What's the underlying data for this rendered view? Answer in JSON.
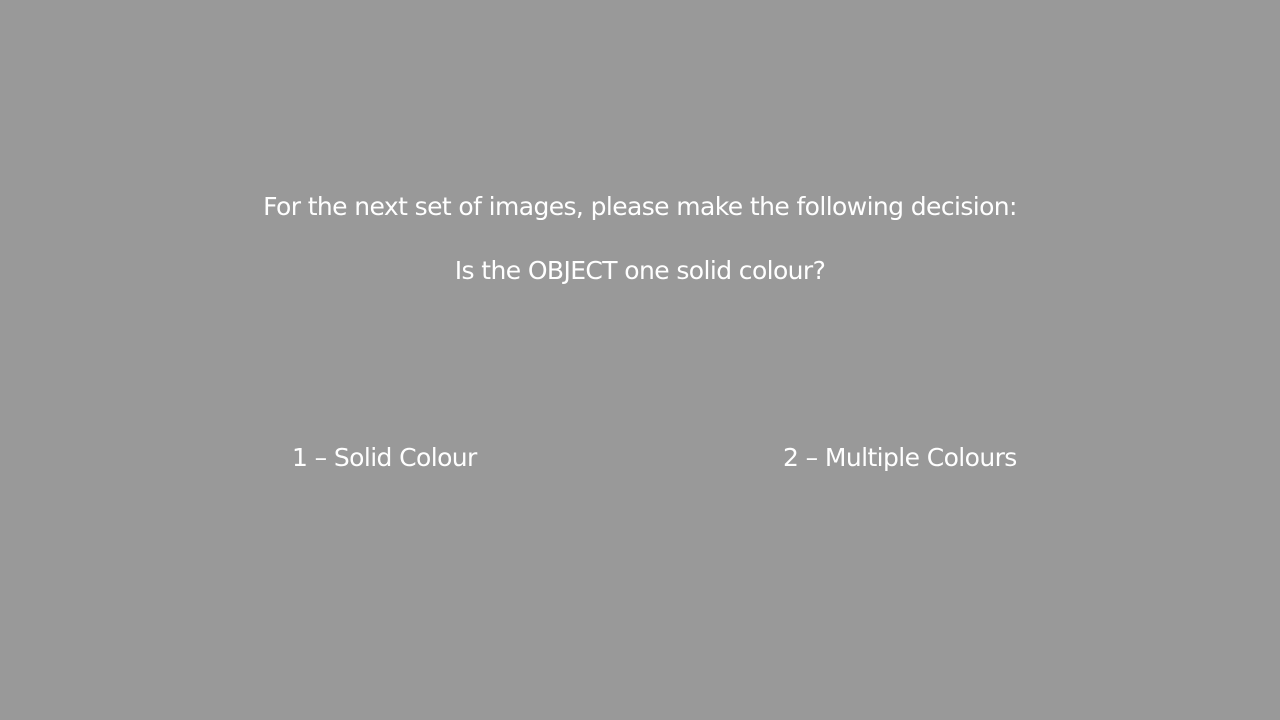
{
  "screen": {
    "background_color": "#999999",
    "text_color": "#ffffff",
    "instruction": "For the next set of images, please make the following decision:",
    "question": "Is the OBJECT one solid colour?",
    "options": [
      {
        "label": "1 – Solid Colour"
      },
      {
        "label": "2 – Multiple Colours"
      }
    ]
  }
}
